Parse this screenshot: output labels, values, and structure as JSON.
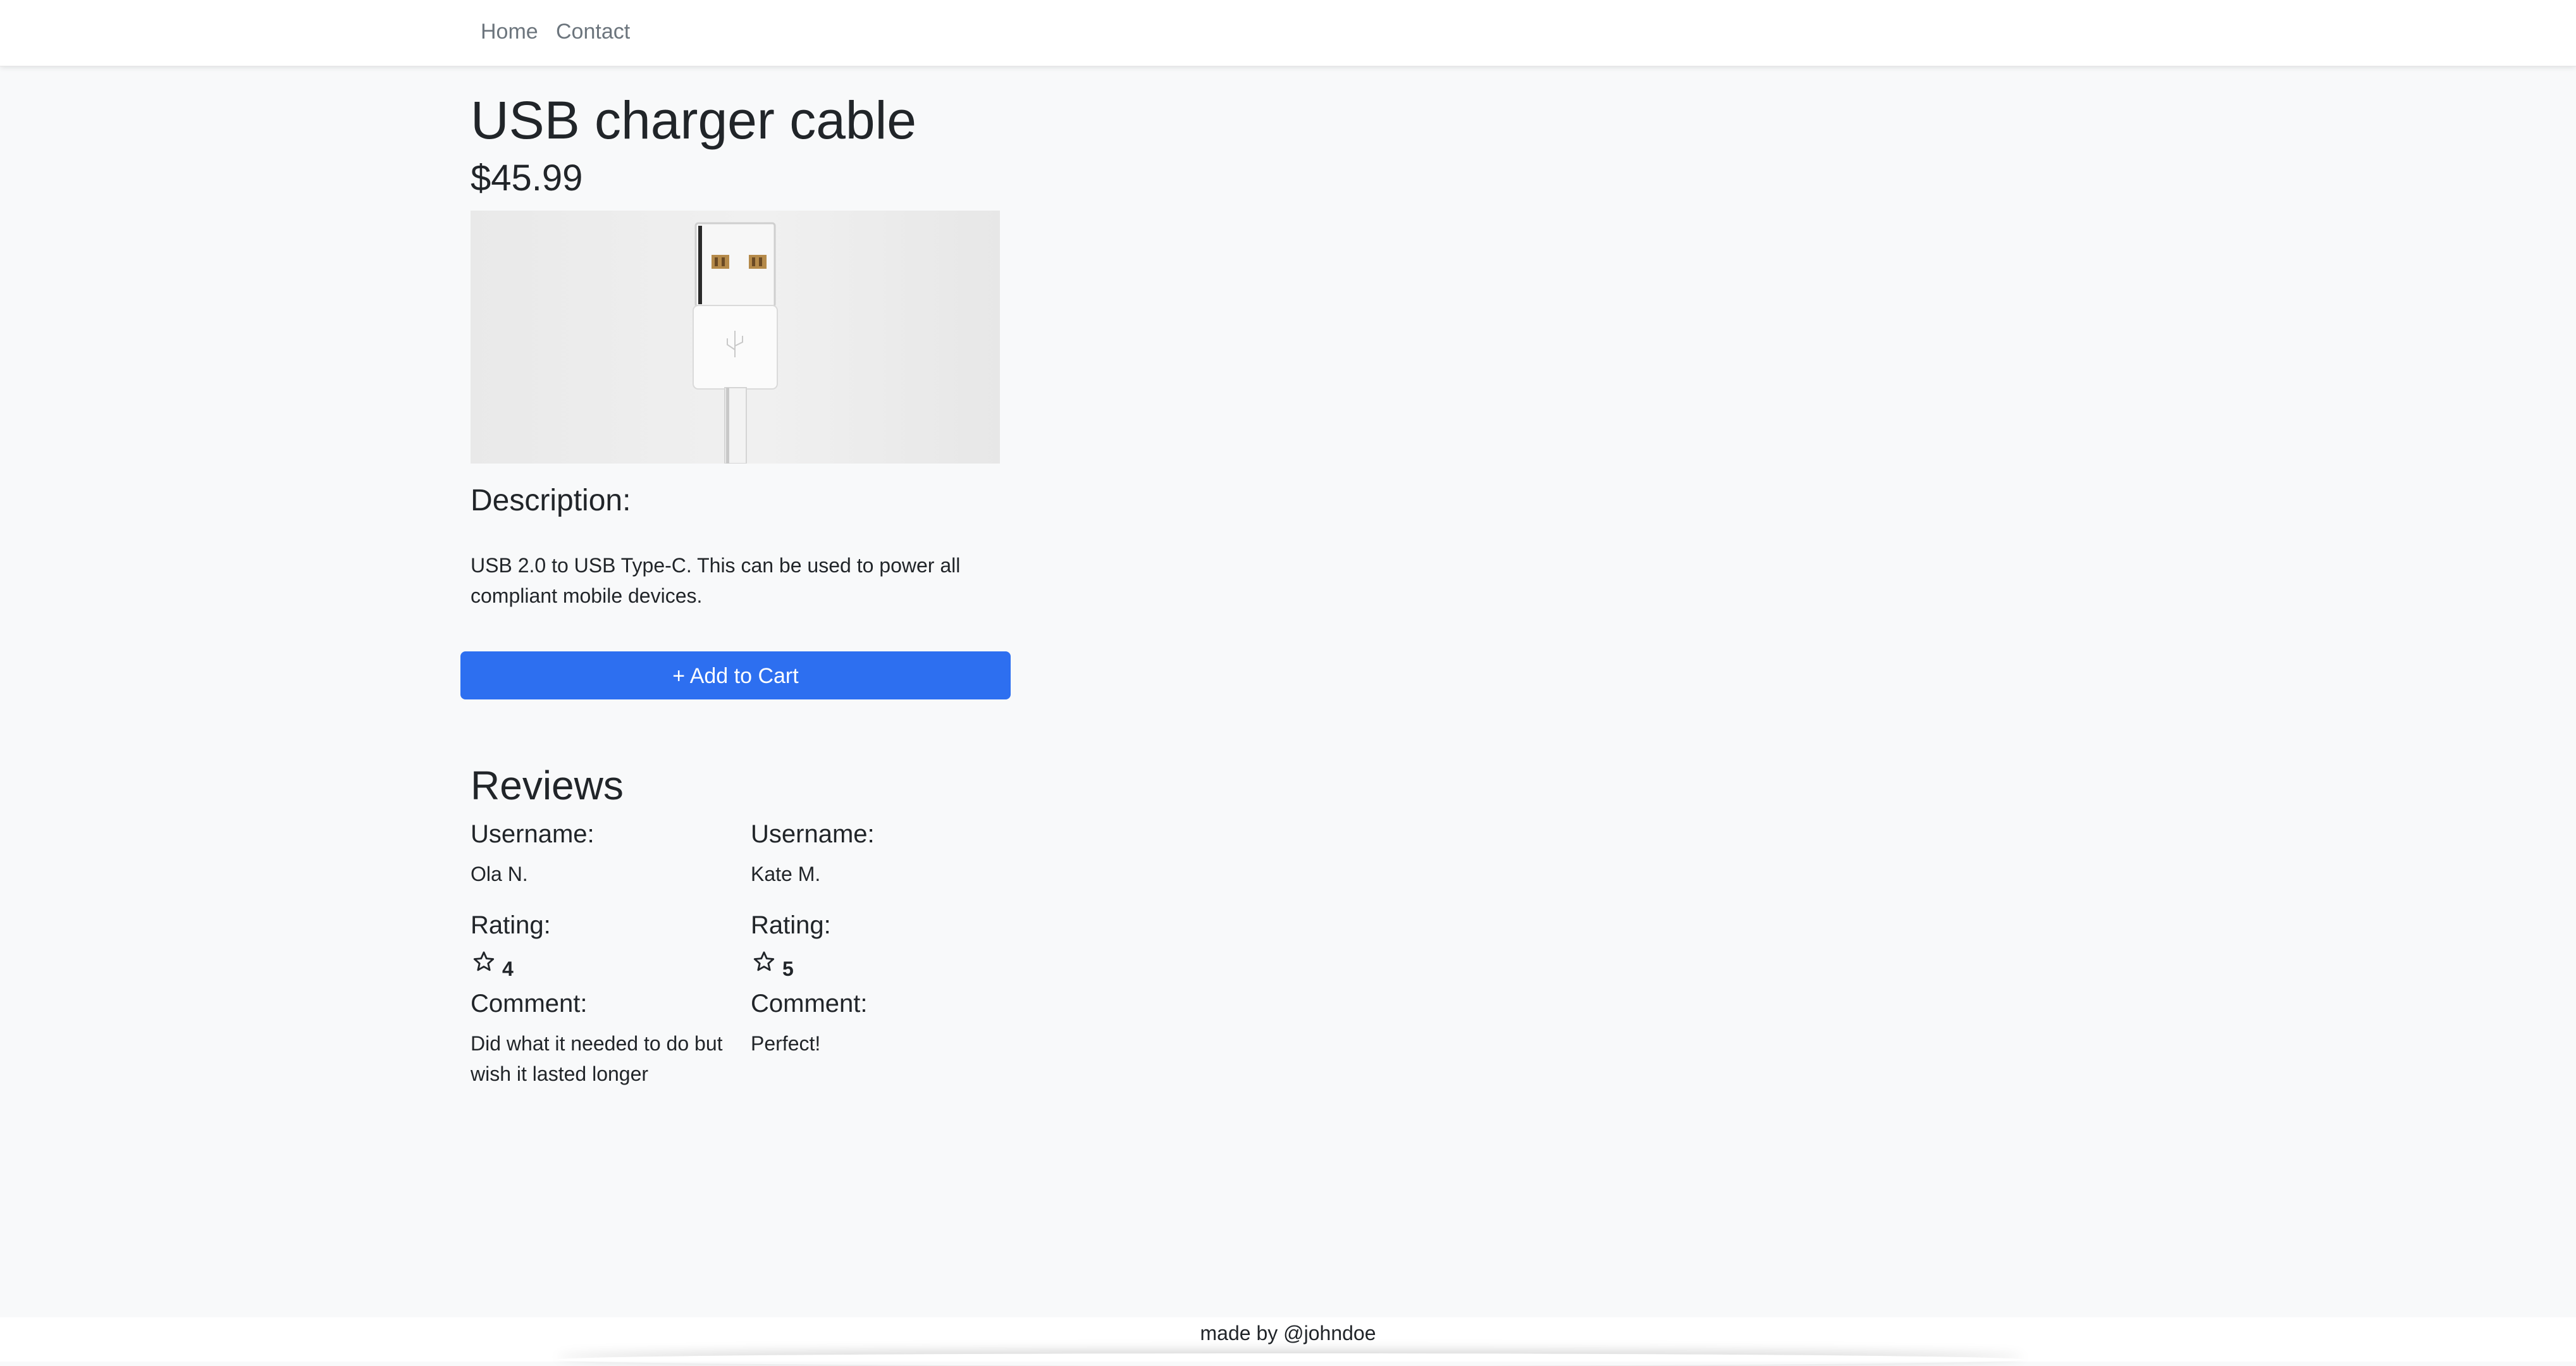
{
  "nav": {
    "home": "Home",
    "contact": "Contact"
  },
  "product": {
    "title": "USB charger cable",
    "price": "$45.99",
    "image_icon": "usb-cable-image",
    "description_heading": "Description:",
    "description": "USB 2.0 to USB Type-C. This can be used to power all compliant mobile devices.",
    "add_to_cart_label": "+ Add to Cart"
  },
  "reviews": {
    "heading": "Reviews",
    "items": [
      {
        "username_label": "Username:",
        "username": "Ola N.",
        "rating_label": "Rating:",
        "rating": "4",
        "comment_label": "Comment:",
        "comment": "Did what it needed to do but wish it lasted longer"
      },
      {
        "username_label": "Username:",
        "username": "Kate M.",
        "rating_label": "Rating:",
        "rating": "5",
        "comment_label": "Comment:",
        "comment": "Perfect!"
      }
    ]
  },
  "footer": {
    "text": "made by @johndoe"
  },
  "colors": {
    "primary_button": "#2d6ff0",
    "background": "#f8f9fa",
    "nav_link": "#6c757d"
  }
}
